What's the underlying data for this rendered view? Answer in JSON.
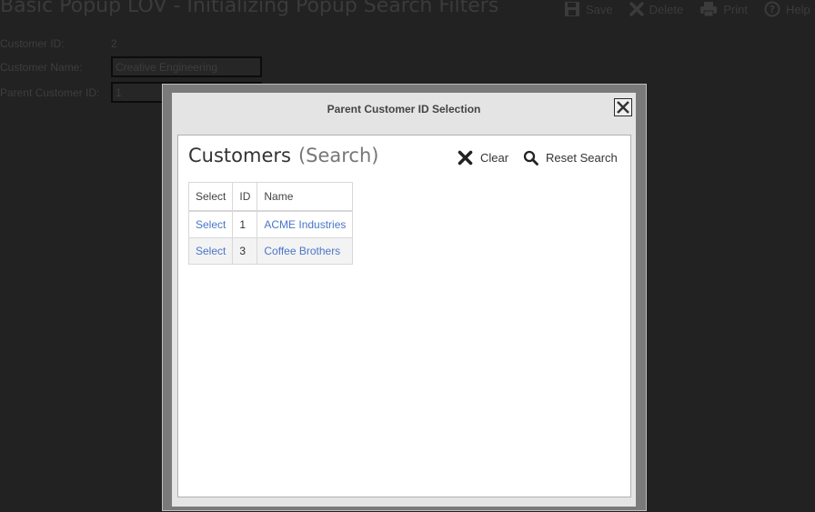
{
  "page": {
    "title": "Basic Popup LOV - Initializing Popup Search Filters",
    "toolbar": [
      {
        "label": "Save",
        "icon": "save-icon"
      },
      {
        "label": "Delete",
        "icon": "delete-icon"
      },
      {
        "label": "Print",
        "icon": "print-icon"
      },
      {
        "label": "Help",
        "icon": "help-icon"
      }
    ],
    "form": {
      "customer_id_label": "Customer ID:",
      "customer_id_value": "2",
      "customer_name_label": "Customer Name:",
      "customer_name_value": "Creative Engineering",
      "parent_id_label": "Parent Customer ID:",
      "parent_id_value": "1"
    }
  },
  "modal": {
    "title": "Parent Customer ID Selection",
    "close_icon": "close-icon",
    "region_title": "Customers",
    "region_subtitle": "(Search)",
    "clear_label": "Clear",
    "reset_label": "Reset Search",
    "table": {
      "headers": [
        "Select",
        "ID",
        "Name"
      ],
      "rows": [
        {
          "select": "Select",
          "id": "1",
          "name": "ACME Industries"
        },
        {
          "select": "Select",
          "id": "3",
          "name": "Coffee Brothers"
        }
      ]
    }
  },
  "colors": {
    "link": "#4a76c8",
    "overlay": "#222222"
  }
}
